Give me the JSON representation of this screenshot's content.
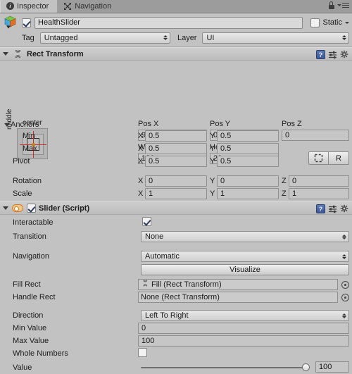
{
  "window": {
    "tabs": [
      {
        "label": "Inspector",
        "icon": "info-icon",
        "active": true
      },
      {
        "label": "Navigation",
        "icon": "navigation-icon",
        "active": false
      }
    ],
    "lock_icon": "lock-icon",
    "menu_icon": "hamburger-menu-icon"
  },
  "gameobject": {
    "icon": "prefab-cube-icon",
    "enabled_checkbox": true,
    "name": "HealthSlider",
    "static_label": "Static",
    "static_checked": false,
    "tag_label": "Tag",
    "tag_value": "Untagged",
    "layer_label": "Layer",
    "layer_value": "UI"
  },
  "rect_transform": {
    "title": "Rect Transform",
    "icon": "rect-transform-icon",
    "help_icon": "help-book-icon",
    "preset_icon": "preset-icon",
    "gear_icon": "gear-icon",
    "anchor_preset": {
      "horizontal": "center",
      "vertical": "middle"
    },
    "pos": {
      "labels": [
        "Pos X",
        "Pos Y",
        "Pos Z"
      ],
      "values": [
        "95",
        "0",
        "0"
      ]
    },
    "size": {
      "labels": [
        "Width",
        "Height"
      ],
      "values": [
        "130",
        "20"
      ]
    },
    "blueprint_button": "blueprint-mode-icon",
    "raw_button": "R",
    "anchors_label": "Anchors",
    "anchors": [
      {
        "label": "Min",
        "x": "0.5",
        "y": "0.5"
      },
      {
        "label": "Max",
        "x": "0.5",
        "y": "0.5"
      }
    ],
    "pivot": {
      "label": "Pivot",
      "x": "0.5",
      "y": "0.5"
    },
    "rotation": {
      "label": "Rotation",
      "x": "0",
      "y": "0",
      "z": "0"
    },
    "scale": {
      "label": "Scale",
      "x": "1",
      "y": "1",
      "z": "1"
    },
    "axis_x": "X",
    "axis_y": "Y",
    "axis_z": "Z"
  },
  "slider_component": {
    "title": "Slider (Script)",
    "icon": "slider-component-icon",
    "enabled_checkbox": true,
    "help_icon": "help-book-icon",
    "preset_icon": "preset-icon",
    "gear_icon": "gear-icon",
    "interactable": {
      "label": "Interactable",
      "checked": true
    },
    "transition": {
      "label": "Transition",
      "value": "None"
    },
    "navigation": {
      "label": "Navigation",
      "value": "Automatic"
    },
    "visualize_button": "Visualize",
    "fill_rect": {
      "label": "Fill Rect",
      "value": "Fill (Rect Transform)",
      "icon": "rect-transform-icon"
    },
    "handle_rect": {
      "label": "Handle Rect",
      "value": "None (Rect Transform)"
    },
    "direction": {
      "label": "Direction",
      "value": "Left To Right"
    },
    "min_value": {
      "label": "Min Value",
      "value": "0"
    },
    "max_value": {
      "label": "Max Value",
      "value": "100"
    },
    "whole_numbers": {
      "label": "Whole Numbers",
      "checked": false
    },
    "value": {
      "label": "Value",
      "value": "100",
      "percent": 100
    }
  }
}
